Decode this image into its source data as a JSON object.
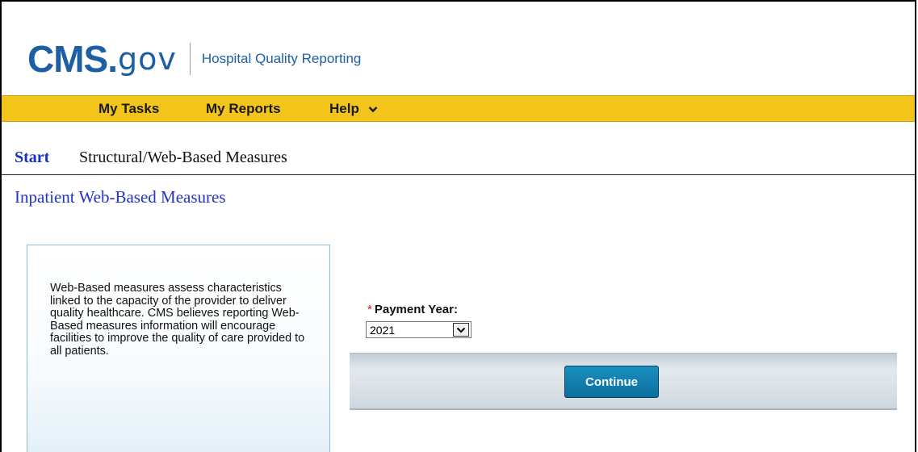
{
  "header": {
    "logo_main": "CMS",
    "logo_dot": ".",
    "logo_gov": "gov",
    "subtitle": "Hospital Quality Reporting"
  },
  "nav": {
    "items": [
      "My Tasks",
      "My Reports",
      "Help"
    ],
    "help_chevron": "chevron-down-icon"
  },
  "breadcrumb": {
    "start": "Start",
    "current": "Structural/Web-Based Measures"
  },
  "page": {
    "title": "Inpatient Web-Based Measures",
    "info_text": "Web-Based measures assess characteristics linked to the capacity of the provider to deliver quality healthcare. CMS believes reporting Web-Based measures information will encourage facilities to improve the quality of care provided to all patients."
  },
  "form": {
    "required_marker": "*",
    "payment_year_label": "Payment Year:",
    "payment_year_value": "2021",
    "continue_label": "Continue"
  },
  "colors": {
    "brand_blue": "#1e5fa3",
    "nav_yellow": "#f3c41a",
    "link_blue": "#1530c4",
    "button_blue": "#0b6f9e"
  }
}
